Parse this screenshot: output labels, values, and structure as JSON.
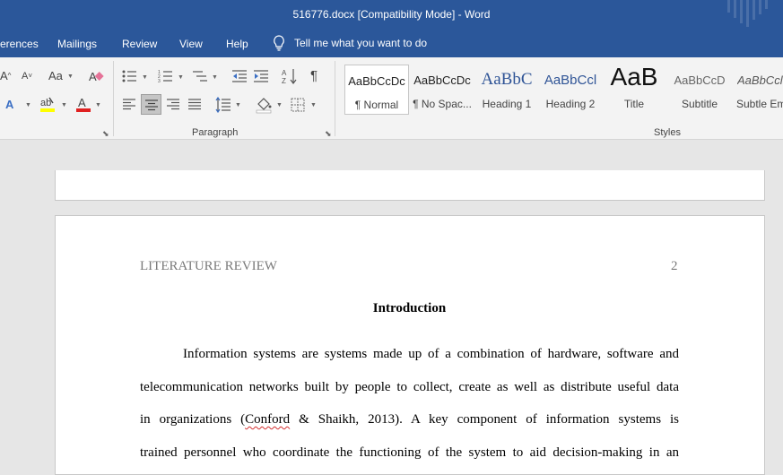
{
  "window": {
    "title": "516776.docx [Compatibility Mode]  -  Word"
  },
  "menu": {
    "tabs": [
      "erences",
      "Mailings",
      "Review",
      "View",
      "Help"
    ],
    "tell_me": "Tell me what you want to do"
  },
  "ribbon": {
    "paragraph_label": "Paragraph",
    "styles_label": "Styles",
    "styles": [
      {
        "preview": "AaBbCcDc",
        "name": "¶ Normal"
      },
      {
        "preview": "AaBbCcDc",
        "name": "¶ No Spac..."
      },
      {
        "preview": "AaBbC",
        "name": "Heading 1"
      },
      {
        "preview": "AaBbCcl",
        "name": "Heading 2"
      },
      {
        "preview": "AaB",
        "name": "Title"
      },
      {
        "preview": "AaBbCcD",
        "name": "Subtitle"
      },
      {
        "preview": "AaBbCcl",
        "name": "Subtle Em"
      }
    ],
    "colors": {
      "highlight": "#ffff00",
      "font_color": "#e02020",
      "accent": "#2b579a"
    }
  },
  "document": {
    "running_head": "LITERATURE REVIEW",
    "page_number": "2",
    "heading": "Introduction",
    "lines": [
      "Information systems are systems made up of a combination of hardware, software and",
      "telecommunication networks built by people to collect, create as well as distribute useful data",
      "trained personnel who coordinate the functioning of the system to aid decision-making in an"
    ],
    "line3": {
      "before": "in organizations (",
      "misspelled": "Conford",
      "after": " & Shaikh, 2013). A key component of information systems is"
    }
  }
}
